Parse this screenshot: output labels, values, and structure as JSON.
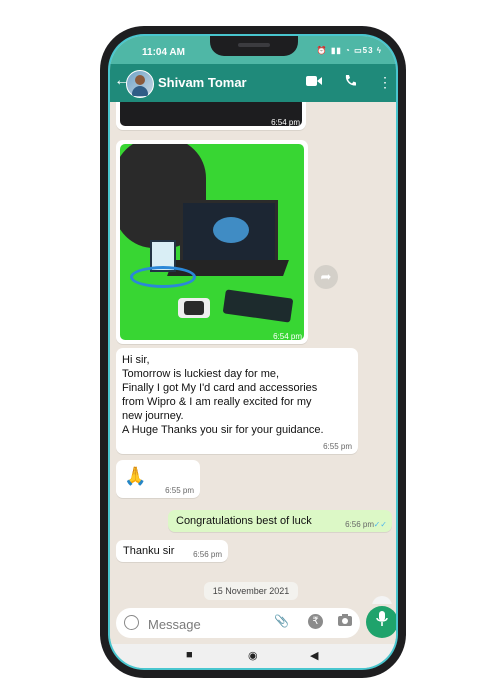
{
  "status_bar": {
    "time": "11:04 AM",
    "battery": "53",
    "icons": [
      "alarm-icon",
      "signal-icon",
      "signal-icon",
      "wifi-icon",
      "battery-icon",
      "charging-icon"
    ]
  },
  "header": {
    "contact_name": "Shivam Tomar",
    "icons": [
      "back-arrow-icon",
      "video-call-icon",
      "voice-call-icon",
      "more-options-icon"
    ]
  },
  "messages": [
    {
      "type": "image",
      "direction": "incoming",
      "time": "6:54 pm"
    },
    {
      "type": "image",
      "direction": "incoming",
      "time": "6:54 pm"
    },
    {
      "type": "text",
      "direction": "incoming",
      "text": "Hi sir,\nTomorrow is luckiest day for me,\n Finally  I got My I'd card and accessories\nfrom Wipro & I am really excited for my\nnew journey.\nA Huge Thanks you sir for your guidance.",
      "time": "6:55 pm"
    },
    {
      "type": "emoji",
      "direction": "incoming",
      "text": "🙏",
      "time": "6:55 pm"
    },
    {
      "type": "text",
      "direction": "outgoing",
      "text": "Congratulations best of luck",
      "time": "6:56 pm",
      "status": "read"
    },
    {
      "type": "text",
      "direction": "incoming",
      "text": "Thanku sir",
      "time": "6:56 pm"
    }
  ],
  "date_separator": "15 November 2021",
  "input": {
    "placeholder": "Message",
    "icons": [
      "emoji-icon",
      "attach-icon",
      "rupee-payment-icon",
      "camera-icon",
      "mic-icon"
    ]
  },
  "colors": {
    "header": "#1f8a7a",
    "statusbar": "#4fb7a6",
    "chat_bg": "#ece5dd",
    "outgoing_bubble": "#dcf8c6",
    "mic_button": "#1fa36c",
    "frame_accent": "#49c6cf"
  }
}
